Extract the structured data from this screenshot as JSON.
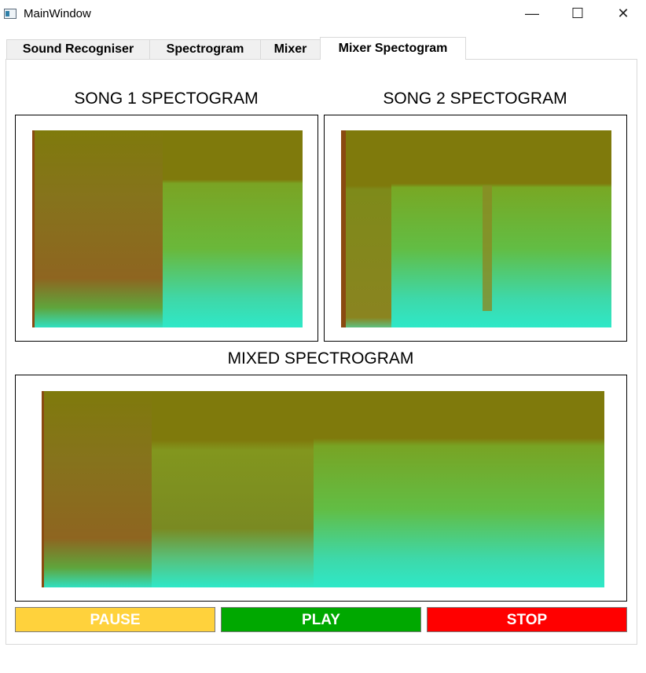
{
  "window": {
    "title": "MainWindow",
    "minimize": "—",
    "maximize": "☐",
    "close": "✕"
  },
  "tabs": [
    {
      "label": "Sound Recogniser",
      "active": false
    },
    {
      "label": "Spectrogram",
      "active": false
    },
    {
      "label": "Mixer",
      "active": false
    },
    {
      "label": "Mixer Spectogram",
      "active": true
    }
  ],
  "song1": {
    "title": "SONG 1 SPECTOGRAM"
  },
  "song2": {
    "title": "SONG 2 SPECTOGRAM"
  },
  "mixed": {
    "title": "MIXED SPECTROGRAM"
  },
  "buttons": {
    "pause": {
      "label": "PAUSE",
      "color": "#ffd23c"
    },
    "play": {
      "label": "PLAY",
      "color": "#00a800"
    },
    "stop": {
      "label": "STOP",
      "color": "#ff0000"
    }
  },
  "colors": {
    "spec_top": "#7f7a0c",
    "spec_mid": "#7ea51a",
    "spec_low": "#2ee8c8",
    "spec_brown": "#8a5a1e"
  }
}
